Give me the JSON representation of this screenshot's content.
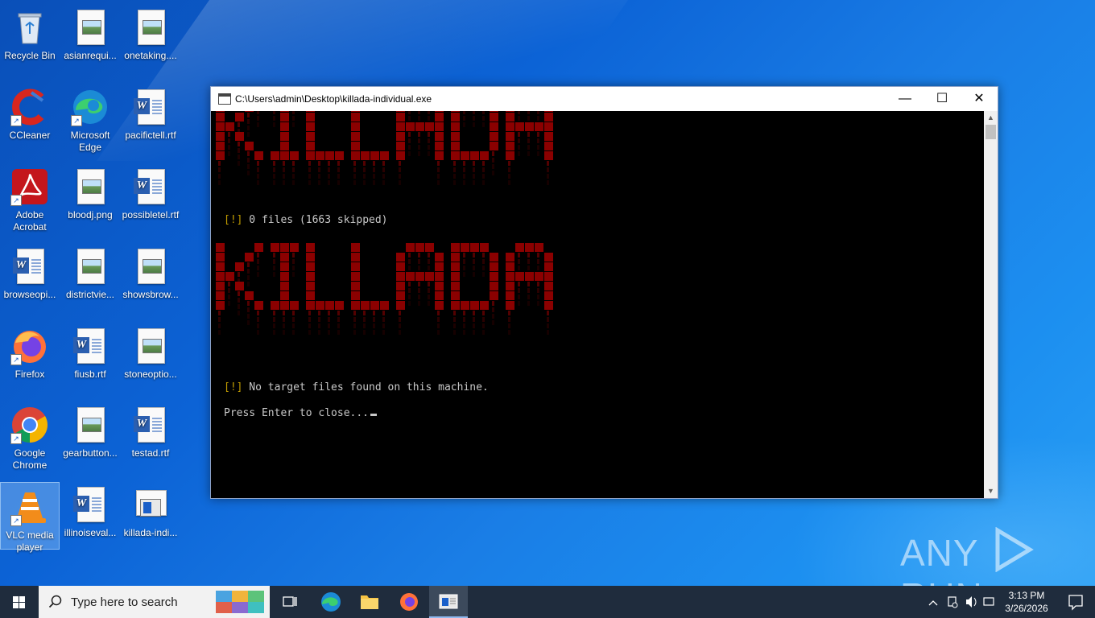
{
  "desktop": {
    "icons": [
      {
        "label": "Recycle Bin",
        "icon": "recycle-bin-icon"
      },
      {
        "label": "asianrequi...",
        "icon": "image-file-icon"
      },
      {
        "label": "onetaking....",
        "icon": "image-file-icon"
      },
      {
        "label": "CCleaner",
        "icon": "ccleaner-icon"
      },
      {
        "label": "Microsoft Edge",
        "icon": "edge-icon"
      },
      {
        "label": "pacifictell.rtf",
        "icon": "word-document-icon"
      },
      {
        "label": "Adobe Acrobat",
        "icon": "acrobat-icon"
      },
      {
        "label": "bloodj.png",
        "icon": "image-file-icon"
      },
      {
        "label": "possibletel.rtf",
        "icon": "word-document-icon"
      },
      {
        "label": "browseopi...",
        "icon": "word-document-icon"
      },
      {
        "label": "districtvie...",
        "icon": "image-file-icon"
      },
      {
        "label": "showsbrow...",
        "icon": "image-file-icon"
      },
      {
        "label": "Firefox",
        "icon": "firefox-icon"
      },
      {
        "label": "fiusb.rtf",
        "icon": "word-document-icon"
      },
      {
        "label": "stoneoptio...",
        "icon": "image-file-icon"
      },
      {
        "label": "Google Chrome",
        "icon": "chrome-icon"
      },
      {
        "label": "gearbutton...",
        "icon": "image-file-icon"
      },
      {
        "label": "testad.rtf",
        "icon": "word-document-icon"
      },
      {
        "label": "VLC media player",
        "icon": "vlc-icon"
      },
      {
        "label": "illinoiseval...",
        "icon": "word-document-icon"
      },
      {
        "label": "killada-indi...",
        "icon": "executable-icon"
      }
    ]
  },
  "window": {
    "title": "C:\\Users\\admin\\Desktop\\killada-individual.exe",
    "minimize": "—",
    "maximize": "☐",
    "close": "✕"
  },
  "console": {
    "banner_color": "#8b0000",
    "bang": "[!]",
    "line1": " 0 files (1663 skipped)",
    "line2": " No target files found on this machine.",
    "line3": "Press Enter to close..."
  },
  "watermark": {
    "left": "ANY",
    "right": "RUN"
  },
  "taskbar": {
    "search_placeholder": "Type here to search",
    "time": "3:13 PM",
    "date": "3/26/2026"
  }
}
